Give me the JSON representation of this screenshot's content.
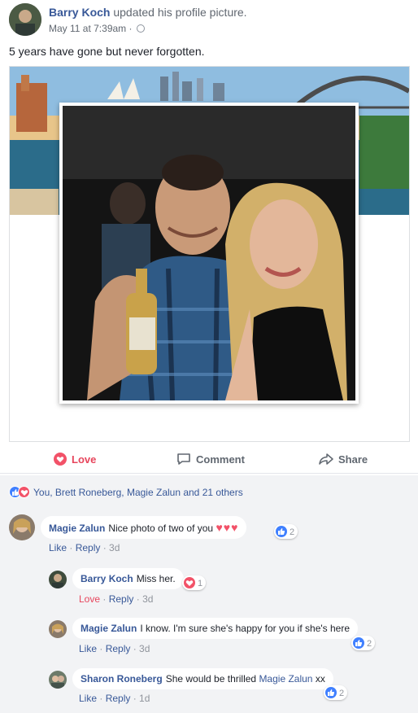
{
  "post": {
    "author": "Barry Koch",
    "action": "updated his profile picture.",
    "date": "May 11 at 7:39am",
    "separator": "·",
    "caption": "5 years have gone but never forgotten."
  },
  "actions": {
    "love": "Love",
    "comment": "Comment",
    "share": "Share"
  },
  "reactions_summary": "You, Brett Roneberg, Magie Zalun and 21 others",
  "comments": [
    {
      "name": "Magie Zalun",
      "text": "Nice photo of two of you",
      "emoji": "♥♥♥",
      "reaction_count": "2",
      "like": "Like",
      "reply": "Reply",
      "time": "3d"
    },
    {
      "name": "Barry Koch",
      "text": "Miss her.",
      "reaction_count": "1",
      "like": "Love",
      "reply": "Reply",
      "time": "3d"
    },
    {
      "name": "Magie Zalun",
      "text": "I know. I'm sure she's happy for you if she's here",
      "reaction_count": "2",
      "like": "Like",
      "reply": "Reply",
      "time": "3d"
    },
    {
      "name": "Sharon Roneberg",
      "text": "She would be thrilled",
      "mention": "Magie Zalun",
      "suffix": "xx",
      "reaction_count": "2",
      "like": "Like",
      "reply": "Reply",
      "time": "1d"
    }
  ],
  "colors": {
    "link": "#385898",
    "love": "#e7455c",
    "like": "#4080ff",
    "muted": "#90949c",
    "panel": "#f2f3f5"
  },
  "icons": [
    "globe-icon",
    "heart-icon",
    "comment-icon",
    "share-icon",
    "like-icon"
  ]
}
